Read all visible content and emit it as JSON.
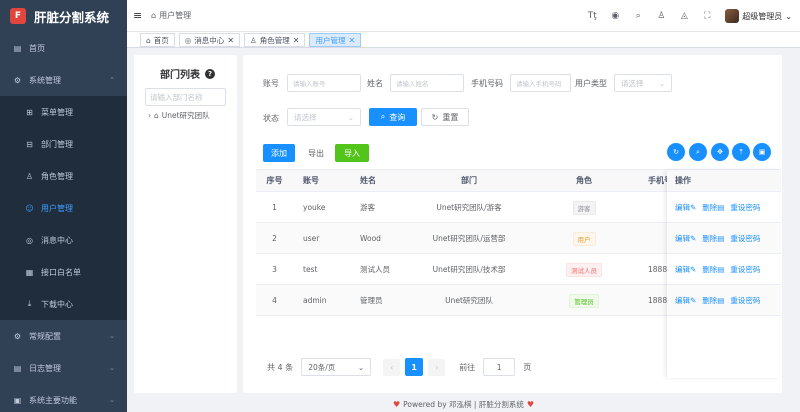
{
  "app": {
    "title": "肝脏分割系统",
    "logo_glyph": "F"
  },
  "sidebar": {
    "items": [
      {
        "label": "首页",
        "icon": "dashboard-icon",
        "glyph": "▤"
      },
      {
        "label": "系统管理",
        "icon": "gear-icon",
        "glyph": "⚙",
        "arrow": "⌃"
      },
      {
        "label": "菜单管理",
        "icon": "tree-table-icon",
        "glyph": "⊞"
      },
      {
        "label": "部门管理",
        "icon": "department-icon",
        "glyph": "⊟"
      },
      {
        "label": "角色管理",
        "icon": "peoples-icon",
        "glyph": "♙"
      },
      {
        "label": "用户管理",
        "icon": "user-icon",
        "glyph": "👤"
      },
      {
        "label": "消息中心",
        "icon": "message-icon",
        "glyph": "◎"
      },
      {
        "label": "接口白名单",
        "icon": "list-icon",
        "glyph": "▦"
      },
      {
        "label": "下载中心",
        "icon": "download-icon",
        "glyph": "⤓"
      },
      {
        "label": "常规配置",
        "icon": "config-icon",
        "glyph": "⚙",
        "arrow": "⌄"
      },
      {
        "label": "日志管理",
        "icon": "log-icon",
        "glyph": "▤",
        "arrow": "⌄"
      },
      {
        "label": "系统主要功能",
        "icon": "function-icon",
        "glyph": "▣",
        "arrow": "⌄"
      }
    ]
  },
  "navbar": {
    "hamburger": "≡",
    "breadcrumb_home_glyph": "⌂",
    "breadcrumb": "用户管理",
    "icons": [
      {
        "name": "font-size-icon",
        "glyph": "Tţ"
      },
      {
        "name": "github-icon",
        "glyph": "◉"
      },
      {
        "name": "search-icon",
        "glyph": "⌕"
      },
      {
        "name": "theme-icon",
        "glyph": "♙"
      },
      {
        "name": "bell-icon",
        "glyph": "◬"
      },
      {
        "name": "fullscreen-icon",
        "glyph": "⛶"
      }
    ],
    "user": "超级管理员",
    "user_arrow": "⌄"
  },
  "tabs": [
    {
      "label": "首页",
      "glyph": "⌂"
    },
    {
      "label": "消息中心",
      "glyph": "◎",
      "close": "✕"
    },
    {
      "label": "角色管理",
      "glyph": "♙",
      "close": "✕"
    },
    {
      "label": "用户管理",
      "glyph": "",
      "close": "✕"
    }
  ],
  "dept": {
    "title": "部门列表",
    "help": "?",
    "search_placeholder": "请输入部门名称",
    "tree_root": "Unet研究团队",
    "tree_arrow": "›",
    "tree_glyph": "⌂"
  },
  "filters": {
    "account_label": "账号",
    "account_placeholder": "请输入账号",
    "name_label": "姓名",
    "name_placeholder": "请输入姓名",
    "phone_label": "手机号码",
    "phone_placeholder": "请输入手机号码",
    "usertype_label": "用户类型",
    "usertype_placeholder": "请选择",
    "status_label": "状态",
    "status_placeholder": "请选择",
    "select_arrow": "⌄",
    "query": "查询",
    "query_glyph": "⌕",
    "reset": "重置",
    "reset_glyph": "↻"
  },
  "toolbar": {
    "add": "添加",
    "export": "导出",
    "import": "导入",
    "tools": [
      {
        "name": "refresh-icon",
        "glyph": "↻"
      },
      {
        "name": "search-toggle-icon",
        "glyph": "⌕"
      },
      {
        "name": "move-icon",
        "glyph": "✥"
      },
      {
        "name": "upload-icon",
        "glyph": "⤒"
      },
      {
        "name": "columns-icon",
        "glyph": "▣"
      }
    ]
  },
  "table": {
    "headers": {
      "index": "序号",
      "account": "账号",
      "name": "姓名",
      "dept": "部门",
      "role": "角色",
      "phone": "手机号",
      "ops": "操作"
    },
    "rows": [
      {
        "index": "1",
        "account": "youke",
        "name": "游客",
        "dept": "Unet研究团队/游客",
        "role": "游客",
        "role_color": "#909399",
        "role_bg": "#f4f4f5",
        "phone": ""
      },
      {
        "index": "2",
        "account": "user",
        "name": "Wood",
        "dept": "Unet研究团队/运营部",
        "role": "用户",
        "role_color": "#e6a23c",
        "role_bg": "#fdf6ec",
        "phone": ""
      },
      {
        "index": "3",
        "account": "test",
        "name": "测试人员",
        "dept": "Unet研究团队/技术部",
        "role": "测试人员",
        "role_color": "#f56c6c",
        "role_bg": "#fef0f0",
        "phone": "1888"
      },
      {
        "index": "4",
        "account": "admin",
        "name": "管理员",
        "dept": "Unet研究团队",
        "role": "管理员",
        "role_color": "#52c41a",
        "role_bg": "#f0f9eb",
        "phone": "1888"
      }
    ],
    "ops": {
      "edit": "编辑",
      "edit_glyph": "✎",
      "delete": "删除",
      "delete_glyph": "🗑",
      "reset_pwd": "重设密码"
    }
  },
  "pager": {
    "total": "共 4 条",
    "page_size": "20条/页",
    "prev": "‹",
    "page": "1",
    "next": "›",
    "goto": "前往",
    "goto_value": "1",
    "page_unit": "页"
  },
  "footer": {
    "text": "Powered by 邓泓棋 | 肝脏分割系统",
    "heart": "♥"
  }
}
